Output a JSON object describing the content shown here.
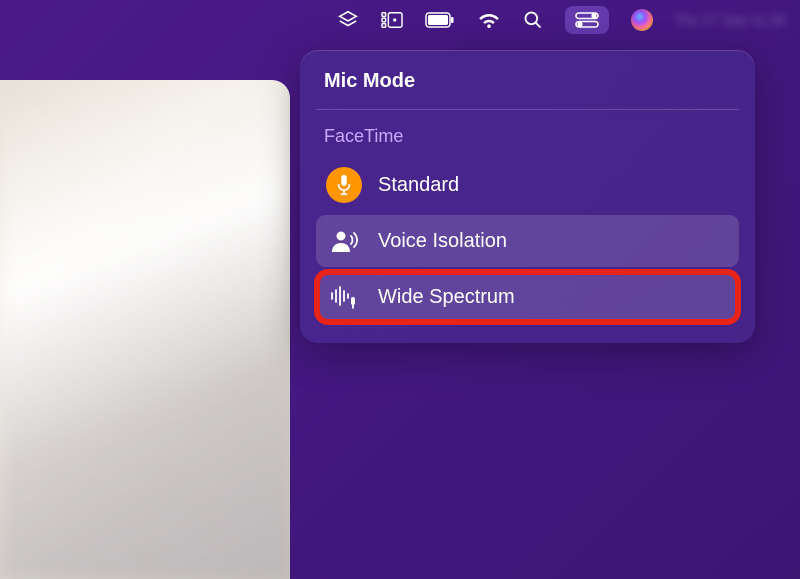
{
  "menubar": {
    "datetime": "Thu 17 Sep 11:26"
  },
  "popover": {
    "title": "Mic Mode",
    "section_label": "FaceTime",
    "modes": [
      {
        "label": "Standard"
      },
      {
        "label": "Voice Isolation"
      },
      {
        "label": "Wide Spectrum"
      }
    ]
  }
}
